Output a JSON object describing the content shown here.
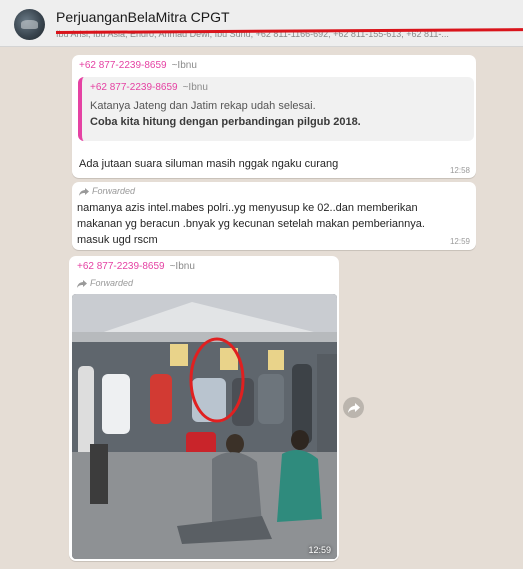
{
  "header": {
    "title": "PerjuanganBelaMitra CPGT",
    "subtitle": "Ibu Arisi, Ibu Asia, Endro, Ahmad Dewi, Ibu Suhu, +62 811-1166-692, +62 811-155-613, +62 811-..."
  },
  "messages": [
    {
      "sender_phone": "+62 877-2239-8659",
      "sender_name": "~Ibnu",
      "quote": {
        "sender_phone": "+62 877-2239-8659",
        "sender_name": "~Ibnu",
        "line1": "Katanya Jateng dan Jatim rekap udah selesai.",
        "line2": "Coba kita hitung dengan perbandingan pilgub 2018."
      },
      "text": "Ada jutaan suara siluman masih nggak ngaku curang",
      "time": "12:58"
    },
    {
      "forwarded_label": "Forwarded",
      "lines": [
        "namanya azis  intel.mabes polri..yg menyusup ke 02..dan memberikan",
        "makanan yg beracun  .bnyak yg kecunan setelah makan pemberiannya.",
        "masuk ugd rscm"
      ],
      "time": "12:59"
    },
    {
      "sender_phone": "+62 877-2239-8659",
      "sender_name": "~Ibnu",
      "forwarded_label": "Forwarded",
      "image_alt": "photo",
      "time": "12:59"
    }
  ],
  "colors": {
    "sender": "#e542a3",
    "chat_bg": "#e5ddd5",
    "bubble": "#ffffff",
    "highlight_circle": "#e02020"
  },
  "icons": {
    "forwarded": "forward-arrow-icon",
    "share": "share-arrow-icon"
  }
}
